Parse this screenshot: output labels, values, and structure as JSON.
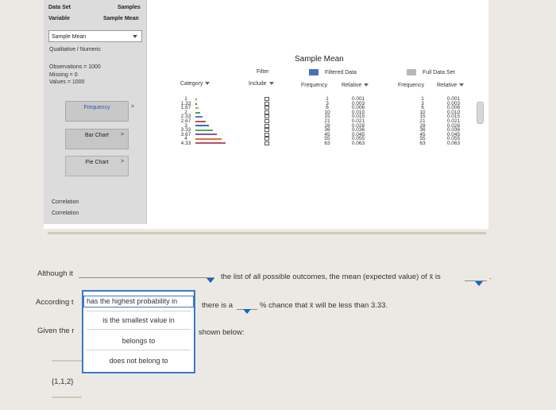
{
  "left_panel": {
    "dataset_label": "Data Set",
    "dataset_value": "Samples",
    "variable_label": "Variable",
    "variable_value": "Sample Mean",
    "selected_variable": "Sample Mean",
    "variable_type": "Qualitative / Numeric",
    "observations": "Observations = 1000",
    "missing": "Missing = 0",
    "values": "Values = 1000",
    "buttons": {
      "frequency": "Frequency",
      "bar_chart": "Bar Chart",
      "pie_chart": "Pie Chart"
    },
    "chevron": ">",
    "correlation_1": "Correlation",
    "correlation_2": "Correlation"
  },
  "table": {
    "title": "Sample Mean",
    "filter_label": "Filter",
    "include_label": "Include",
    "category_label": "Category",
    "filtered_label": "Filtered Data",
    "full_label": "Full Data Set",
    "frequency_label": "Frequency",
    "relative_label": "Relative",
    "categories": [
      "1",
      "1.33",
      "1.67",
      "2",
      "2.33",
      "2.67",
      "3",
      "3.33",
      "3.67",
      "4",
      "4.33"
    ],
    "frequencies": [
      "1",
      "3",
      "6",
      "10",
      "15",
      "21",
      "28",
      "36",
      "45",
      "55",
      "63"
    ],
    "relatives": [
      "0.001",
      "0.003",
      "0.006",
      "0.010",
      "0.015",
      "0.021",
      "0.028",
      "0.036",
      "0.045",
      "0.055",
      "0.063"
    ],
    "full_frequencies": [
      "1",
      "3",
      "6",
      "10",
      "15",
      "21",
      "28",
      "36",
      "45",
      "55",
      "63"
    ],
    "full_relatives": [
      "0.001",
      "0.003",
      "0.006",
      "0.010",
      "0.015",
      "0.021",
      "0.028",
      "0.036",
      "0.045",
      "0.055",
      "0.063"
    ],
    "bar_colors": [
      "#8c8c8c",
      "#6a6a6a",
      "#c9a24a",
      "#4da34d",
      "#4a7bd0",
      "#c0504d",
      "#2f6fbf",
      "#5aa85a",
      "#7a56b0",
      "#d07a3a",
      "#c04a6a"
    ],
    "filtered_color": "#4a6fb5",
    "full_color": "#b8b8b8"
  },
  "question": {
    "line1_start": "Although it",
    "line1_end": "the list of all possible outcomes, the mean (expected value) of",
    "xbar": "x̄",
    "is": "is",
    "line1_tail": ".",
    "line2_start": "According t",
    "line2_mid": "there is a",
    "line2_end": "% chance that",
    "line2_tail": "will be less than 3.33.",
    "line3_start": "Given the r",
    "line3_end": "shown below:",
    "sample": "{1,1,2}"
  },
  "dropdown_menu": {
    "items": [
      "has the highest probability in",
      "is the smallest value in",
      "belongs to",
      "does not belong to"
    ]
  }
}
